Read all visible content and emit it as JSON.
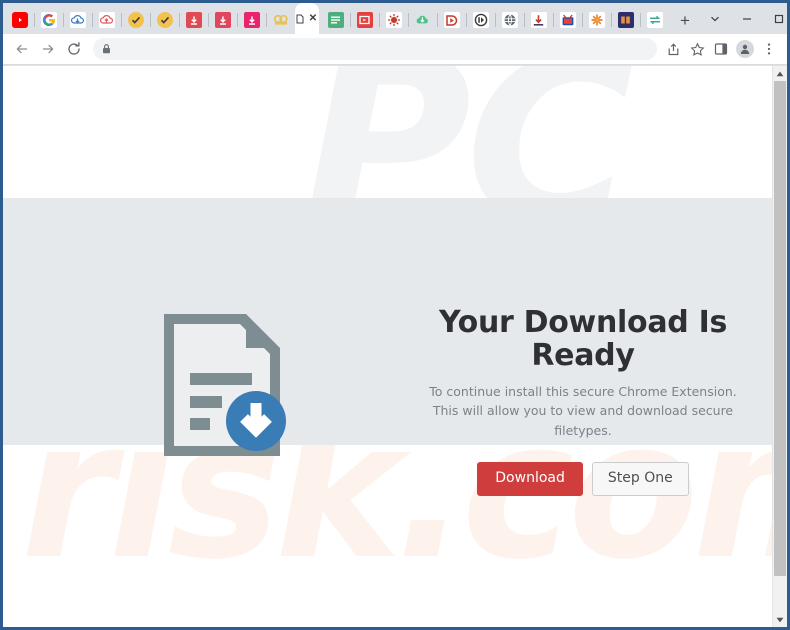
{
  "window": {
    "controls": [
      {
        "name": "tab-search",
        "glyph": "∨"
      },
      {
        "name": "minimize",
        "glyph": "–"
      },
      {
        "name": "maximize",
        "glyph": "□"
      },
      {
        "name": "close",
        "glyph": "✕"
      }
    ],
    "frame_color": "#2d5d90"
  },
  "tabstrip": {
    "pinned_tabs": [
      {
        "name": "tab-youtube",
        "icon": "youtube-icon",
        "color": "#ff0000"
      },
      {
        "name": "tab-google",
        "icon": "google-g-icon",
        "color": "#ffffff"
      },
      {
        "name": "tab-cloud-blue",
        "icon": "cloud-download-icon",
        "color": "#ffffff"
      },
      {
        "name": "tab-cloud-red",
        "icon": "cloud-upload-icon",
        "color": "#ffffff"
      },
      {
        "name": "tab-check-gold-1",
        "icon": "check-badge-icon",
        "color": "#f2c14e"
      },
      {
        "name": "tab-check-gold-2",
        "icon": "check-badge-icon",
        "color": "#f2c14e"
      },
      {
        "name": "tab-download-red-1",
        "icon": "download-box-icon",
        "color": "#e04a52"
      },
      {
        "name": "tab-download-red-2",
        "icon": "download-box-icon",
        "color": "#e0475e"
      },
      {
        "name": "tab-download-pink",
        "icon": "download-box-icon",
        "color": "#e8256b"
      },
      {
        "name": "tab-projector",
        "icon": "video-camera-icon",
        "color": "#efc94c"
      }
    ],
    "active_tab": {
      "name": "tab-active",
      "favicon": "page-icon",
      "close_glyph": "✕"
    },
    "trailing_tabs": [
      {
        "name": "tab-notes-green",
        "icon": "list-lines-icon",
        "color": "#4caf7d"
      },
      {
        "name": "tab-video-red",
        "icon": "video-play-icon",
        "color": "#e4403f"
      },
      {
        "name": "tab-burst-red",
        "icon": "burst-icon",
        "color": "#ffffff"
      },
      {
        "name": "tab-cloud-green",
        "icon": "cloud-arrow-icon",
        "color": "#4cc38a"
      },
      {
        "name": "tab-play-red",
        "icon": "play-shield-icon",
        "color": "#ffffff"
      },
      {
        "name": "tab-disc-dark",
        "icon": "disc-icon",
        "color": "#ffffff"
      },
      {
        "name": "tab-globe-grey",
        "icon": "globe-icon",
        "color": "#ffffff"
      },
      {
        "name": "tab-download-arrow",
        "icon": "download-arrow-icon",
        "color": "#ffffff"
      },
      {
        "name": "tab-tv-blue",
        "icon": "tv-icon",
        "color": "#ffffff"
      },
      {
        "name": "tab-spark-orange",
        "icon": "spark-icon",
        "color": "#ffffff"
      },
      {
        "name": "tab-player-navy",
        "icon": "media-player-icon",
        "color": "#2c2f6b"
      },
      {
        "name": "tab-sync-teal",
        "icon": "sync-icon",
        "color": "#ffffff"
      }
    ],
    "new_tab": {
      "name": "new-tab-button",
      "glyph": "+"
    }
  },
  "toolbar": {
    "back": {
      "name": "back-button",
      "glyph": "←"
    },
    "forward": {
      "name": "forward-button",
      "glyph": "→"
    },
    "reload": {
      "name": "reload-button",
      "glyph": "⟳"
    },
    "omnibox": {
      "name": "address-bar",
      "lock_icon": "padlock-icon",
      "url": "",
      "placeholder": ""
    },
    "right_actions": [
      {
        "name": "share-button",
        "icon": "share-icon"
      },
      {
        "name": "bookmark-button",
        "icon": "star-icon"
      },
      {
        "name": "side-panel-button",
        "icon": "side-panel-icon"
      },
      {
        "name": "profile-button",
        "icon": "avatar-icon"
      },
      {
        "name": "menu-button",
        "icon": "three-dots-icon"
      }
    ]
  },
  "page": {
    "watermark_primary": "PC",
    "watermark_secondary": "risk.com",
    "hero": {
      "headline": "Your Download Is Ready",
      "subline_line1": "To continue install this secure Chrome Extension.",
      "subline_line2": "This will allow you to view and download secure filetypes.",
      "primary_button": "Download",
      "secondary_button": "Step One",
      "primary_color": "#cf3d3d",
      "band_color": "#e6e9ec",
      "illustration": "document-download-icon"
    }
  },
  "scrollbar": {
    "name": "page-scrollbar",
    "up_glyph": "▲",
    "down_glyph": "▼"
  }
}
